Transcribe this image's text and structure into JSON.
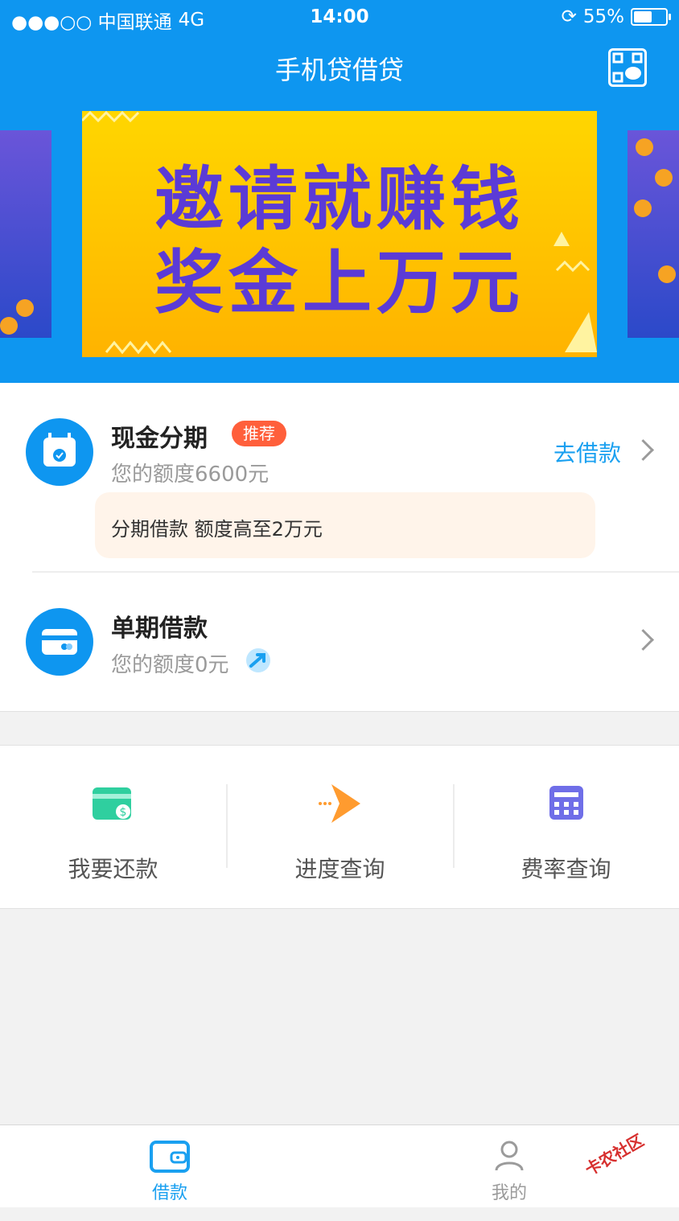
{
  "status": {
    "carrier": "●●●○○ 中国联通",
    "network": "4G",
    "time": "14:00",
    "battery_text": "55%",
    "battery_level": 0.55
  },
  "header": {
    "title": "手机贷借贷",
    "qr_icon": "qr-wechat-icon"
  },
  "banner": {
    "line1": "邀请就赚钱",
    "line2": "奖金上万元"
  },
  "cash_installment": {
    "title": "现金分期",
    "tag": "推荐",
    "quota": "您的额度6600元",
    "action": "去借款",
    "promo": "分期借款 额度高至2万元"
  },
  "single_loan": {
    "title": "单期借款",
    "quota": "您的额度0元"
  },
  "shortcuts": [
    {
      "label": "我要还款",
      "icon": "repay-card-icon"
    },
    {
      "label": "进度查询",
      "icon": "progress-arrow-icon"
    },
    {
      "label": "费率查询",
      "icon": "calculator-icon"
    }
  ],
  "tabbar": {
    "loan": "借款",
    "mine": "我的",
    "active_color": "#1aa0f0"
  },
  "watermark": "卡农社区",
  "colors": {
    "primary": "#0e96f0",
    "tag": "#ff5f3b",
    "banner_text": "#5b3bd6"
  }
}
